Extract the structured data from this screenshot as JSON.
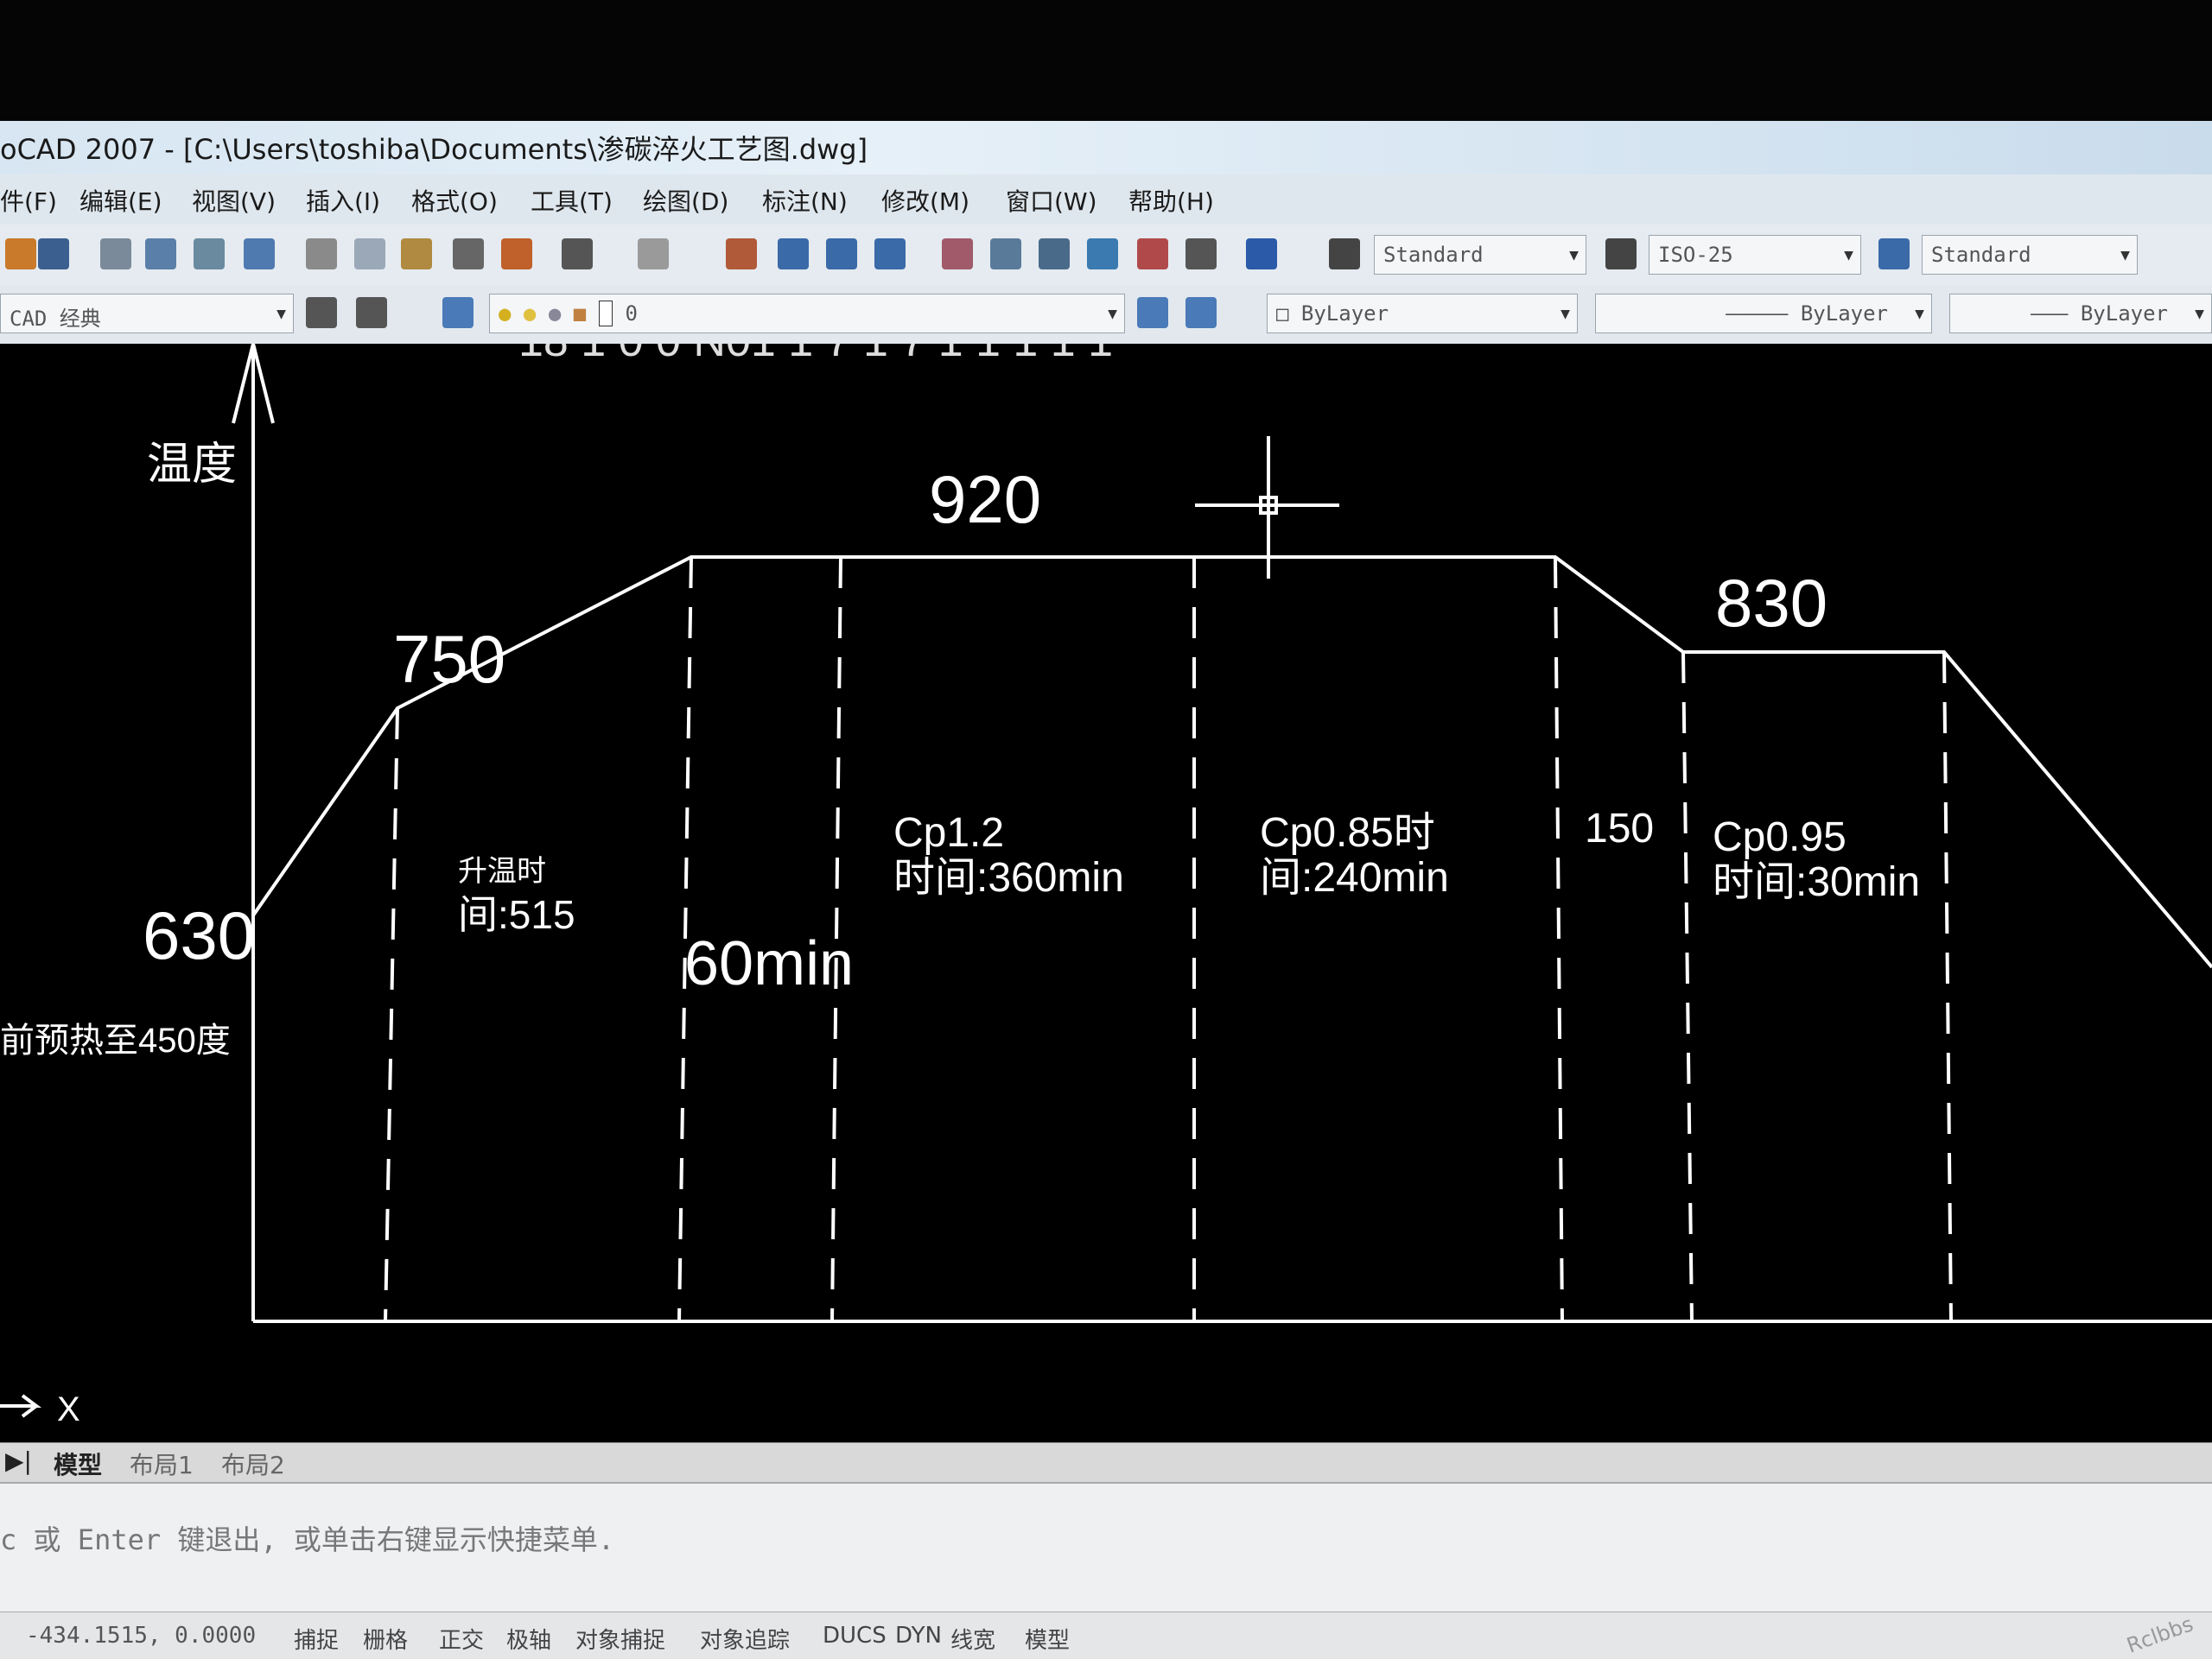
{
  "window": {
    "title": "oCAD 2007 - [C:\\Users\\toshiba\\Documents\\渗碳淬火工艺图.dwg]"
  },
  "menu": {
    "items": [
      "件(F)",
      "编辑(E)",
      "视图(V)",
      "插入(I)",
      "格式(O)",
      "工具(T)",
      "绘图(D)",
      "标注(N)",
      "修改(M)",
      "窗口(W)",
      "帮助(H)"
    ]
  },
  "toolbar": {
    "text_style": "Standard",
    "dim_style": "ISO-25",
    "table_style": "Standard",
    "workspace": "CAD 经典",
    "layer": "0",
    "color": "ByLayer",
    "linetype": "ByLayer",
    "lineweight": "ByLayer"
  },
  "drawing": {
    "title_fragment": "18 1 0 0 N01 1 7 1 7 1 1 1 1 1",
    "y_axis_label": "温度",
    "temps": {
      "t630": "630",
      "t750": "750",
      "t920": "920",
      "t830": "830"
    },
    "preheat_note": "前预热至450度",
    "zones": {
      "heat_label_line1": "升温时",
      "heat_label_line2": "间:515",
      "z2_time": "60min",
      "z3_cp": "Cp1.2",
      "z3_time": "时间:360min",
      "z4_cp": "Cp0.85时",
      "z4_time": "间:240min",
      "z5_time": "150",
      "z6_cp": "Cp0.95",
      "z6_time": "时间:30min"
    },
    "ucs_x_label": "X"
  },
  "tabs": {
    "model": "模型",
    "layout1": "布局1",
    "layout2": "布局2"
  },
  "command_line": {
    "text": "c 或 Enter 键退出, 或单击右键显示快捷菜单."
  },
  "status": {
    "coords": "-434.1515, 0.0000",
    "buttons": [
      "捕捉",
      "栅格",
      "正交",
      "极轴",
      "对象捕捉",
      "对象追踪",
      "DUCS",
      "DYN",
      "线宽",
      "模型"
    ]
  },
  "watermark": "Rclbbs"
}
